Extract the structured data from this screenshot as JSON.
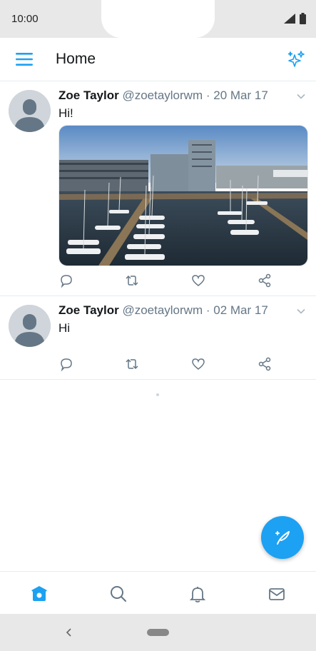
{
  "status_bar": {
    "time": "10:00"
  },
  "app_bar": {
    "title": "Home"
  },
  "tweets": [
    {
      "name": "Zoe Taylor",
      "handle": "@zoetaylorwm",
      "date": "20 Mar 17",
      "text": "Hi!",
      "has_media": true
    },
    {
      "name": "Zoe Taylor",
      "handle": "@zoetaylorwm",
      "date": "02 Mar 17",
      "text": "Hi",
      "has_media": false
    }
  ],
  "icons": {
    "menu": "hamburger-menu-icon",
    "top_right": "sparkle-icon",
    "reply": "reply-icon",
    "retweet": "retweet-icon",
    "like": "heart-icon",
    "share": "share-icon",
    "compose": "compose-feather-icon",
    "nav_home": "home-icon",
    "nav_search": "search-icon",
    "nav_notifications": "bell-icon",
    "nav_messages": "mail-icon"
  },
  "colors": {
    "accent": "#1da1f2",
    "text": "#14171a",
    "muted": "#657786"
  }
}
